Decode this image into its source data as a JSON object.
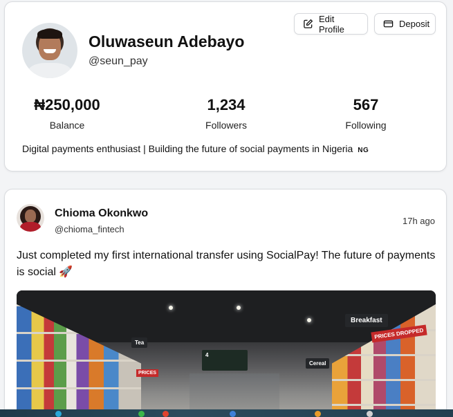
{
  "profile": {
    "name": "Oluwaseun Adebayo",
    "handle": "@seun_pay",
    "edit_button_label": "Edit Profile",
    "deposit_button_label": "Deposit",
    "stats": {
      "balance": {
        "value": "₦250,000",
        "label": "Balance"
      },
      "followers": {
        "value": "1,234",
        "label": "Followers"
      },
      "following": {
        "value": "567",
        "label": "Following"
      }
    },
    "bio": "Digital payments enthusiast | Building the future of social payments in Nigeria",
    "bio_flag": "NG"
  },
  "post": {
    "author_name": "Chioma Okonkwo",
    "author_handle": "@chioma_fintech",
    "time": "17h ago",
    "text": "Just completed my first international transfer using SocialPay! The future of payments is social 🚀",
    "image": {
      "signs": {
        "breakfast": "Breakfast",
        "tea": "Tea",
        "cereal": "Cereal",
        "center": "4",
        "prices": "PRICES DROPPED",
        "left_price": "PRICES"
      }
    }
  },
  "colors": {
    "page_background": "#f3f4f6",
    "card_background": "#ffffff",
    "border": "#d9dbdf"
  },
  "icons": {
    "edit": "pencil-square-icon",
    "deposit": "credit-card-icon"
  }
}
